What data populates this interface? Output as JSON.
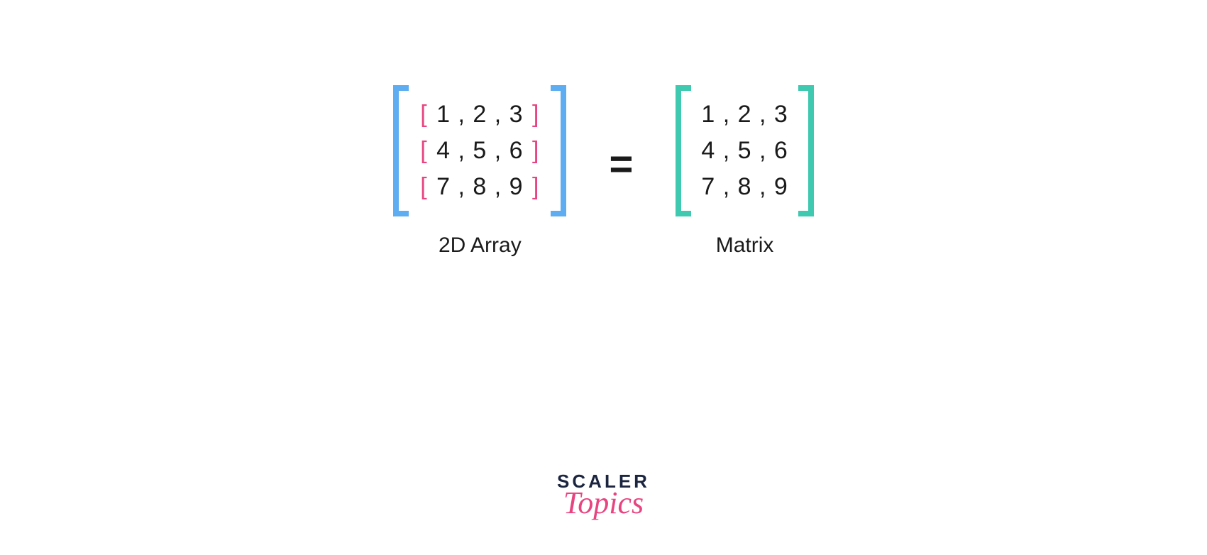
{
  "array_block": {
    "caption": "2D Array",
    "rows": [
      [
        "1",
        "2",
        "3"
      ],
      [
        "4",
        "5",
        "6"
      ],
      [
        "7",
        "8",
        "9"
      ]
    ],
    "outer_bracket_color": "#5eadf2",
    "inner_bracket_color": "#e8447f"
  },
  "equals_symbol": "=",
  "matrix_block": {
    "caption": "Matrix",
    "rows": [
      [
        "1",
        "2",
        "3"
      ],
      [
        "4",
        "5",
        "6"
      ],
      [
        "7",
        "8",
        "9"
      ]
    ],
    "outer_bracket_color": "#3ec9b0"
  },
  "separator": " , ",
  "logo": {
    "line1": "SCALER",
    "line2": "Topics"
  }
}
